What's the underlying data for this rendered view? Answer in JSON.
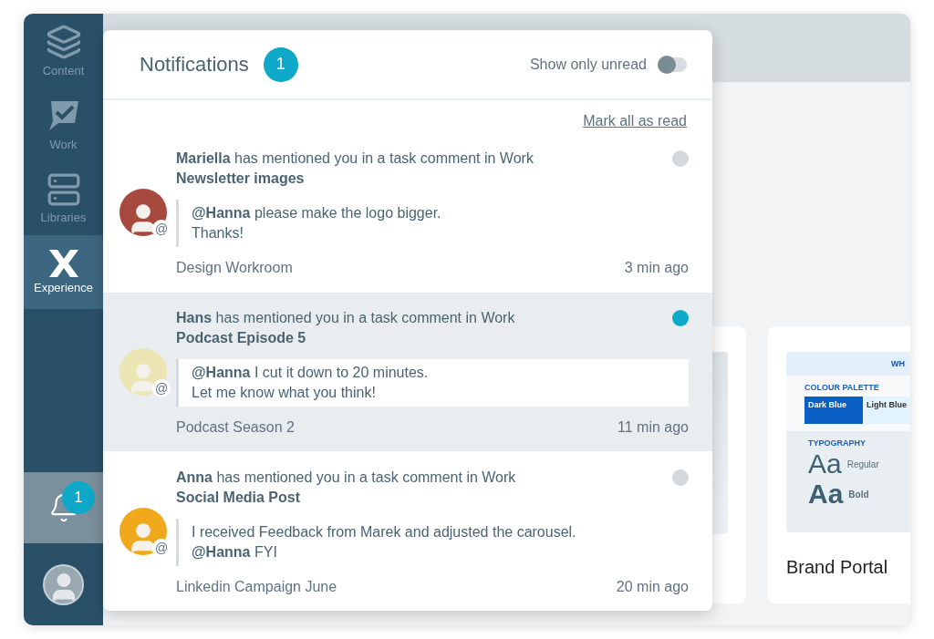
{
  "sidebar": {
    "items": [
      {
        "kind": "layers",
        "label": "Content",
        "selected": false
      },
      {
        "kind": "work",
        "label": "Work",
        "selected": false
      },
      {
        "kind": "libraries",
        "label": "Libraries",
        "selected": false
      },
      {
        "kind": "experience",
        "label": "Experience",
        "selected": true
      }
    ],
    "notifications_button": {
      "badge": "1",
      "selected": true
    }
  },
  "brand_card": {
    "title": "Brand Portal",
    "preview": {
      "header": "WH",
      "palette_title": "COLOUR PALETTE",
      "swatches": [
        {
          "name": "Dark Blue",
          "color": "#0b5fc4"
        },
        {
          "name": "Light Blue",
          "color": "#e3f2ff"
        }
      ],
      "typography_title": "TYPOGRAPHY",
      "samples": [
        {
          "glyphs": "Aa",
          "weight": "Regular"
        },
        {
          "glyphs": "Aa",
          "weight": "Bold"
        }
      ]
    }
  },
  "panel": {
    "title": "Notifications",
    "count": "1",
    "toggle": {
      "label": "Show only unread",
      "on": false
    },
    "mark_all": "Mark all as read",
    "items": [
      {
        "author": "Mariella",
        "action": "has mentioned you in a task comment in Work",
        "subject": "Newsletter images",
        "lines": [
          "**@Hanna** please make the logo bigger.",
          "Thanks!"
        ],
        "mention_mark": "@",
        "source": "Design Workroom",
        "time": "3 min ago",
        "unread": false,
        "color": "#a8493f"
      },
      {
        "author": "Hans",
        "action": "has mentioned you in a task comment in Work",
        "subject": "Podcast Episode 5",
        "lines": [
          "**@Hanna** I cut it down to 20 minutes.",
          "Let me know what you think!"
        ],
        "mention_mark": "@",
        "source": "Podcast Season 2",
        "time": "11 min ago",
        "unread": true,
        "color": "#ece6b4"
      },
      {
        "author": "Anna",
        "action": "has mentioned you in a task comment in Work",
        "subject": "Social Media Post",
        "lines": [
          "I received Feedback from Marek and adjusted the carousel.",
          "**@Hanna** FYI"
        ],
        "mention_mark": "@",
        "source": "Linkedin Campaign June",
        "time": "20 min ago",
        "unread": false,
        "color": "#f0a81c"
      }
    ]
  }
}
